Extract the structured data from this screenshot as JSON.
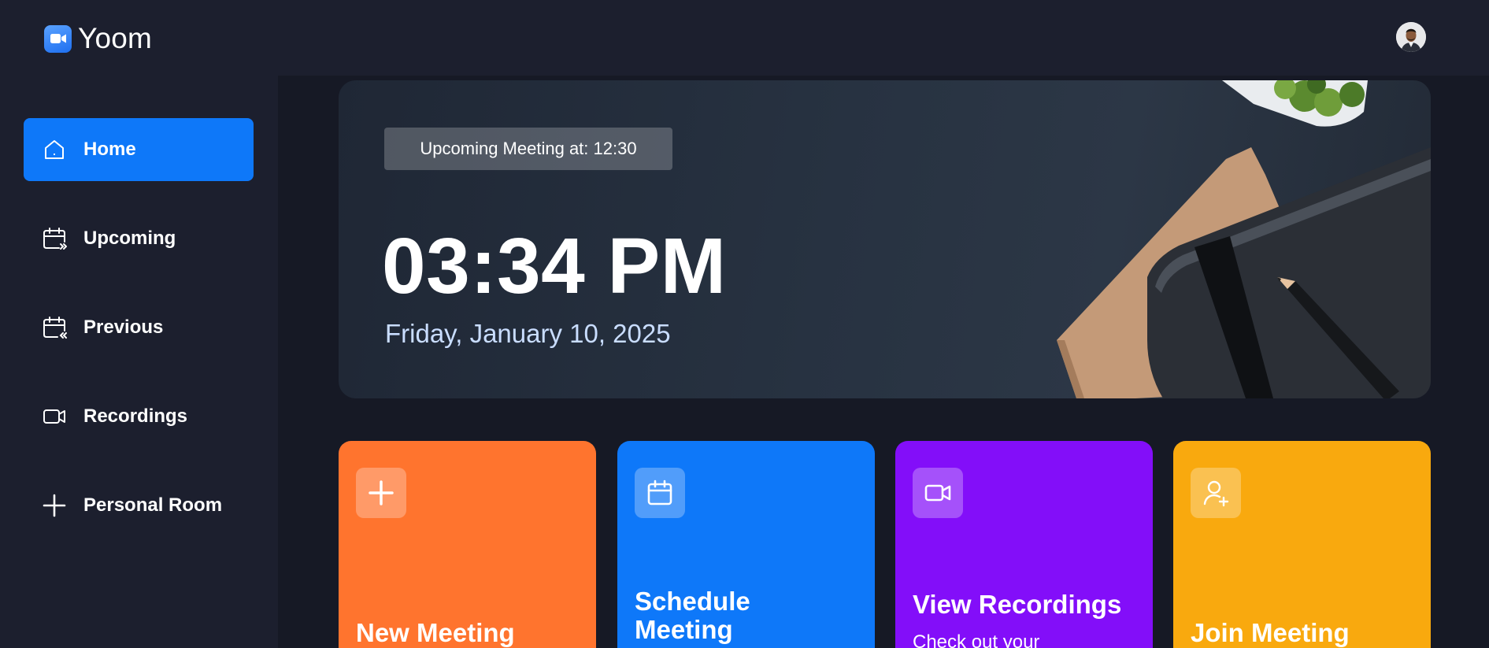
{
  "app": {
    "name": "Yoom",
    "logo_icon": "video-camera-icon",
    "avatar_icon": "user-avatar"
  },
  "sidebar": {
    "items": [
      {
        "label": "Home",
        "icon": "home-icon",
        "active": true
      },
      {
        "label": "Upcoming",
        "icon": "calendar-forward-icon",
        "active": false
      },
      {
        "label": "Previous",
        "icon": "calendar-back-icon",
        "active": false
      },
      {
        "label": "Recordings",
        "icon": "video-icon",
        "active": false
      },
      {
        "label": "Personal Room",
        "icon": "plus-icon",
        "active": false
      }
    ]
  },
  "hero": {
    "upcoming_text": "Upcoming Meeting at: 12:30",
    "time": "03:34 PM",
    "date": "Friday, January 10, 2025"
  },
  "cards": [
    {
      "title": "New Meeting",
      "subtitle": "",
      "icon": "plus-icon",
      "color": "#ff742e"
    },
    {
      "title": "Schedule Meeting",
      "subtitle": "",
      "icon": "calendar-icon",
      "color": "#0e78f9"
    },
    {
      "title": "View Recordings",
      "subtitle": "Check out your",
      "icon": "video-icon",
      "color": "#830ef9"
    },
    {
      "title": "Join Meeting",
      "subtitle": "",
      "icon": "user-plus-icon",
      "color": "#f9a90e"
    }
  ],
  "colors": {
    "background": "#1c1f2e",
    "main_background": "#161925",
    "accent": "#0e78f9"
  }
}
